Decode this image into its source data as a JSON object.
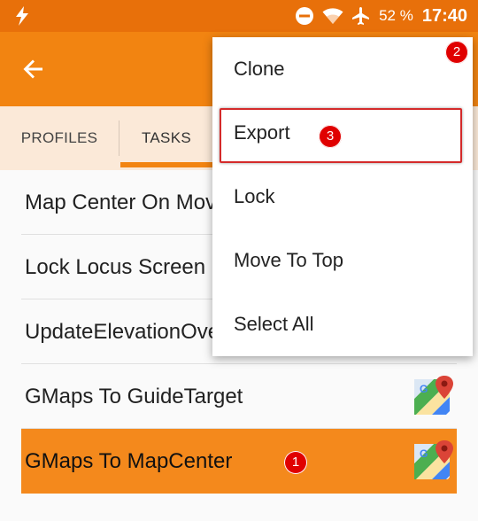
{
  "status_bar": {
    "battery_percent": "52 %",
    "time": "17:40",
    "icons": [
      "bolt-icon",
      "do-not-disturb-icon",
      "wifi-icon",
      "airplane-icon"
    ]
  },
  "app_bar": {
    "back_icon": "arrow-back-icon",
    "color": "#f28411"
  },
  "tabs": [
    {
      "label": "PROFILES",
      "active": false
    },
    {
      "label": "TASKS",
      "active": true
    }
  ],
  "tasks": [
    {
      "label": "Map Center On Mov",
      "icon": null,
      "selected": false
    },
    {
      "label": "Lock Locus Screen",
      "icon": null,
      "selected": false
    },
    {
      "label": "UpdateElevationOve",
      "icon": null,
      "selected": false
    },
    {
      "label": "GMaps To GuideTarget",
      "icon": "google-maps-icon",
      "selected": false
    },
    {
      "label": "GMaps To MapCenter",
      "icon": "google-maps-icon",
      "selected": true
    }
  ],
  "menu": {
    "items": [
      {
        "label": "Clone"
      },
      {
        "label": "Export"
      },
      {
        "label": "Lock"
      },
      {
        "label": "Move To Top"
      },
      {
        "label": "Select All"
      }
    ]
  },
  "annotations": [
    "1",
    "2",
    "3"
  ],
  "colors": {
    "status_bar": "#e8700a",
    "accent": "#f28411",
    "selected_row": "#f4891c",
    "tab_bar": "#fbe9d8",
    "badge": "#e00000"
  }
}
